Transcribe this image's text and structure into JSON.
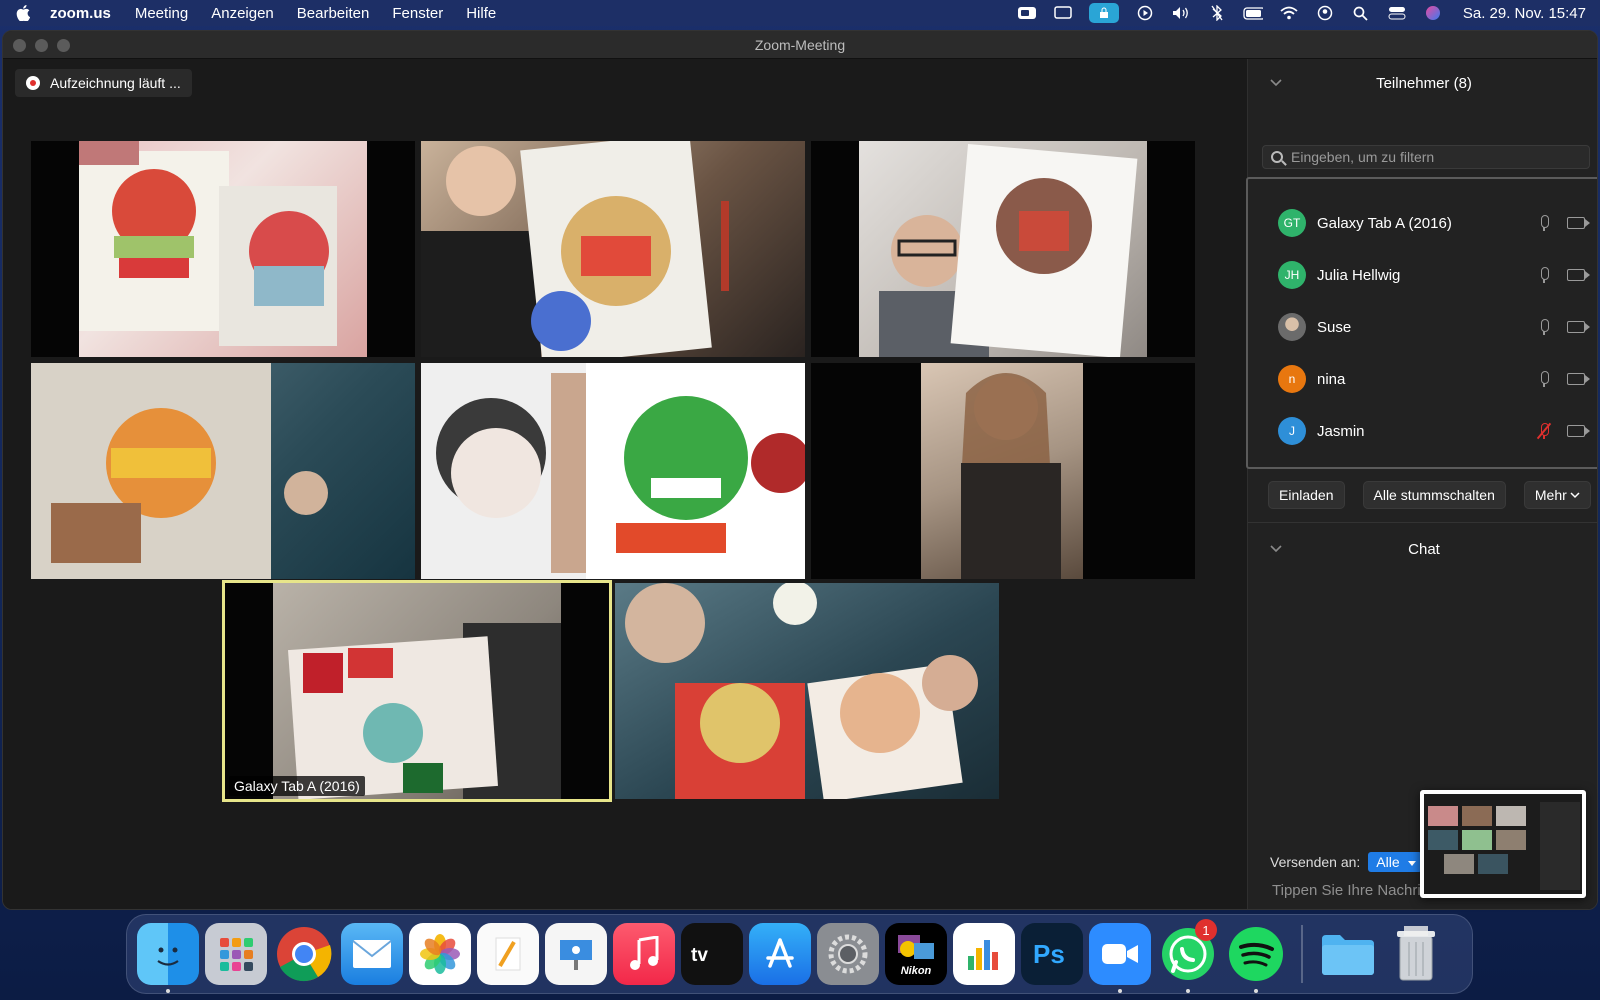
{
  "menubar": {
    "app_name": "zoom.us",
    "menus": [
      "Meeting",
      "Anzeigen",
      "Bearbeiten",
      "Fenster",
      "Hilfe"
    ],
    "clock": "Sa. 29. Nov.  15:47"
  },
  "window": {
    "title": "Zoom-Meeting",
    "recording_label": "Aufzeichnung läuft ..."
  },
  "video": {
    "active_speaker_label": "Galaxy Tab A (2016)"
  },
  "participants": {
    "header": "Teilnehmer (8)",
    "filter_placeholder": "Eingeben, um zu filtern",
    "list": [
      {
        "initials": "GT",
        "name": "Galaxy Tab A (2016)",
        "color": "#2fb36b",
        "muted": false
      },
      {
        "initials": "JH",
        "name": "Julia Hellwig",
        "color": "#2fb36b",
        "muted": false
      },
      {
        "initials": "",
        "name": "Suse",
        "color": "#8b8f8f",
        "muted": false
      },
      {
        "initials": "n",
        "name": "nina",
        "color": "#e8770f",
        "muted": false
      },
      {
        "initials": "J",
        "name": "Jasmin",
        "color": "#2e8fd8",
        "muted": true
      }
    ],
    "buttons": {
      "invite": "Einladen",
      "mute_all": "Alle stummschalten",
      "more": "Mehr"
    }
  },
  "chat": {
    "header": "Chat",
    "send_to_label": "Versenden an:",
    "send_to_value": "Alle",
    "input_placeholder": "Tippen Sie Ihre Nachri"
  },
  "dock": {
    "whatsapp_badge": "1",
    "nikon_label": "Nikon"
  }
}
